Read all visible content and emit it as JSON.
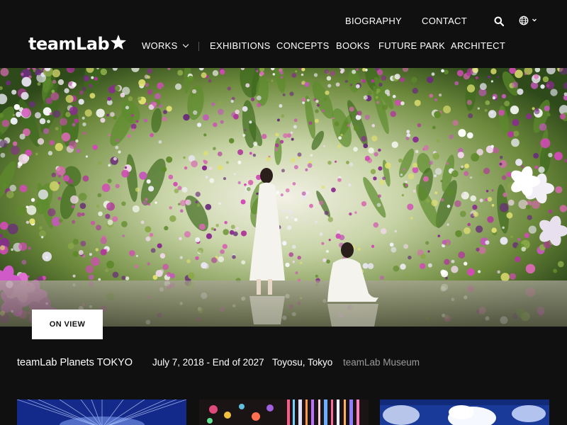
{
  "logo": {
    "text": "teamLab",
    "mark": "star-icon"
  },
  "nav_top": {
    "biography": "BIOGRAPHY",
    "contact": "CONTACT",
    "search_icon": "search-icon",
    "language_icon": "globe-icon"
  },
  "nav_main": {
    "works": "WORKS",
    "exhibitions": "EXHIBITIONS",
    "concepts": "CONCEPTS",
    "books": "BOOKS",
    "future_park": "FUTURE PARK",
    "architect": "ARCHITECT"
  },
  "hero": {
    "badge": "ON VIEW"
  },
  "exhibition": {
    "title": "teamLab Planets TOKYO",
    "dates": "July 7, 2018 - End of 2027",
    "location": "Toyosu, Tokyo",
    "category": "teamLab Museum"
  },
  "colors": {
    "background": "#101010",
    "text": "#ffffff",
    "muted": "#9a9a9a",
    "badge_bg": "#ffffff"
  }
}
